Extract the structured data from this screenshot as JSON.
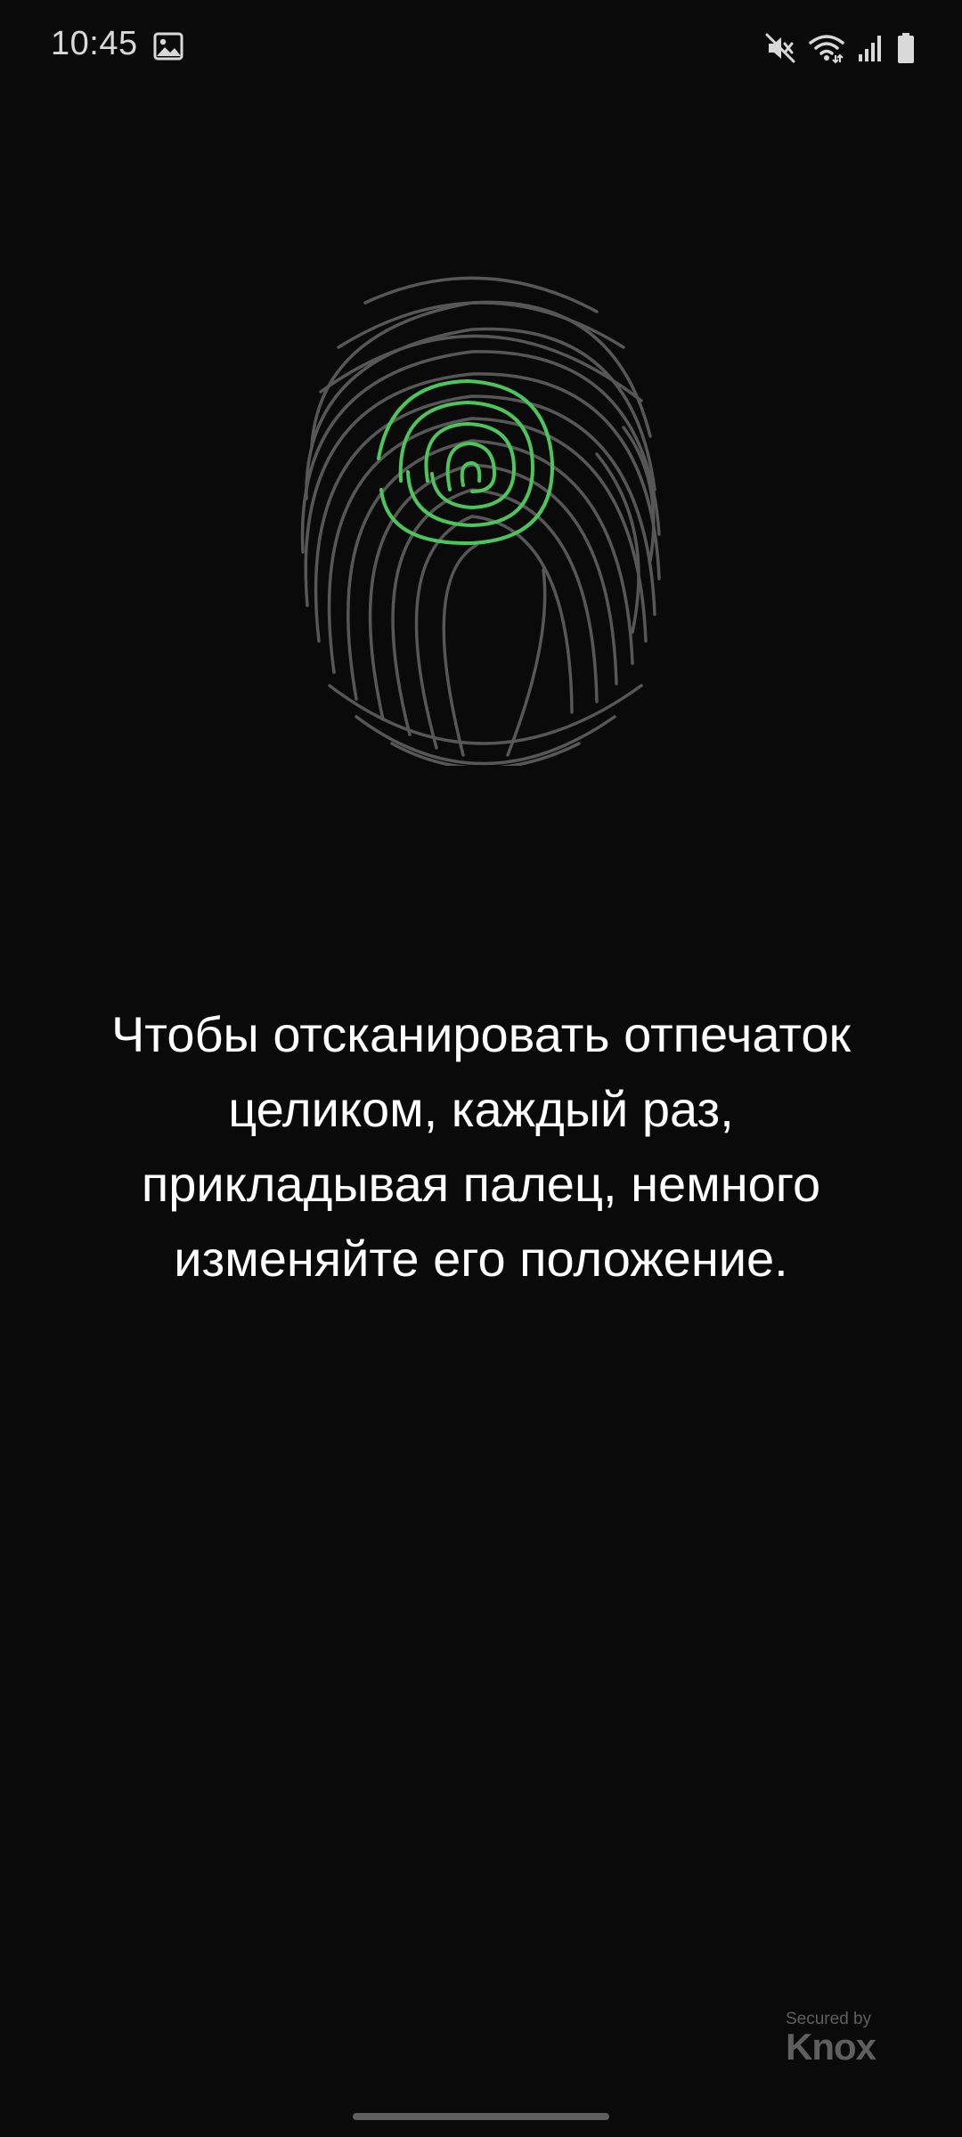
{
  "status_bar": {
    "time": "10:45",
    "left_icons": [
      "gallery-icon"
    ],
    "right_icons": [
      "vibrate-mute-icon",
      "wifi-icon",
      "signal-icon",
      "battery-icon"
    ]
  },
  "fingerprint": {
    "icon": "fingerprint-icon",
    "progress_color": "#4cc55c",
    "ridge_color": "#5a5a5a"
  },
  "instruction": {
    "text": "Чтобы отсканировать отпечаток целиком, каждый раз, прикладывая палец, немного изменяйте его положение."
  },
  "knox": {
    "secured_by": "Secured by",
    "brand": "Knox"
  },
  "colors": {
    "background": "#0a0a0a",
    "text": "#ffffff",
    "accent_green": "#4cc55c"
  }
}
